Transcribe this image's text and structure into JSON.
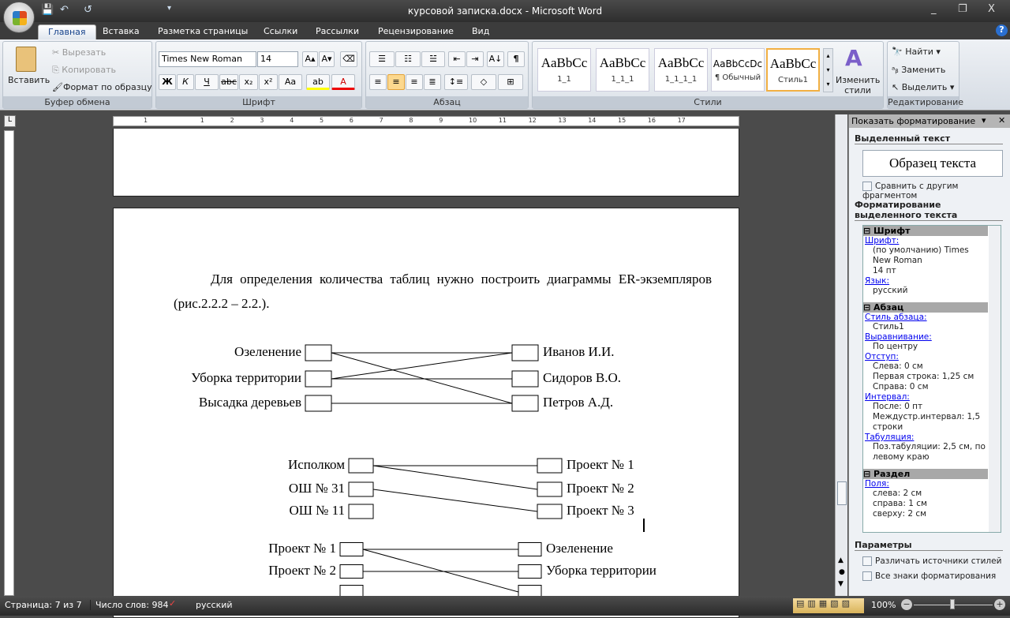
{
  "window": {
    "title": "курсовой записка.docx - Microsoft Word",
    "minimize": "_",
    "restore": "❐",
    "close": "X"
  },
  "quick_access": {
    "save": "💾",
    "undo": "↶",
    "redo": "↺",
    "more": "▾"
  },
  "tabs": [
    "Главная",
    "Вставка",
    "Разметка страницы",
    "Ссылки",
    "Рассылки",
    "Рецензирование",
    "Вид"
  ],
  "help": "?",
  "clipboard": {
    "paste": "Вставить",
    "cut": "Вырезать",
    "copy": "Копировать",
    "format_painter": "Формат по образцу",
    "label": "Буфер обмена"
  },
  "font": {
    "name": "Times New Roman",
    "size": "14",
    "bold": "Ж",
    "italic": "К",
    "underline": "Ч",
    "strike": "abc",
    "sub": "x₂",
    "sup": "x²",
    "case": "Aa",
    "grow": "A▴",
    "shrink": "A▾",
    "label": "Шрифт"
  },
  "paragraph": {
    "label": "Абзац",
    "pilcrow": "¶",
    "sort": "А↓"
  },
  "styles": {
    "items": [
      {
        "preview": "AaBbCc",
        "name": "1_1"
      },
      {
        "preview": "AaBbCc",
        "name": "1_1_1"
      },
      {
        "preview": "AaBbCc",
        "name": "1_1_1_1"
      },
      {
        "preview": "AaBbCcDc",
        "name": "¶ Обычный"
      },
      {
        "preview": "AaBbCc",
        "name": "Стиль1"
      }
    ],
    "change": "Изменить стили",
    "label": "Стили"
  },
  "editing": {
    "find": "Найти",
    "replace": "Заменить",
    "select": "Выделить",
    "label": "Редактирование"
  },
  "ruler": {
    "marks": [
      "1",
      "1",
      "2",
      "3",
      "4",
      "5",
      "6",
      "7",
      "8",
      "9",
      "10",
      "11",
      "12",
      "13",
      "14",
      "15",
      "16",
      "17"
    ]
  },
  "document": {
    "paragraph": "Для определения количества таблиц нужно построить диаграммы ER-экземпляров (рис.2.2.2 – 2.2.).",
    "diagram1": {
      "left": [
        "Озеленение",
        "Уборка территории",
        "Высадка деревьев"
      ],
      "right": [
        "Иванов И.И.",
        "Сидоров В.О.",
        "Петров А.Д."
      ],
      "links": [
        [
          0,
          0
        ],
        [
          0,
          2
        ],
        [
          1,
          0
        ],
        [
          1,
          1
        ],
        [
          2,
          2
        ]
      ]
    },
    "diagram2": {
      "left": [
        "Исполком",
        "ОШ № 31",
        "ОШ № 11"
      ],
      "right": [
        "Проект № 1",
        "Проект № 2",
        "Проект № 3"
      ],
      "links": [
        [
          0,
          0
        ],
        [
          0,
          1
        ],
        [
          1,
          2
        ]
      ]
    },
    "diagram3": {
      "left": [
        "Проект № 1",
        "Проект № 2"
      ],
      "right": [
        "Озеленение",
        "Уборка территории"
      ],
      "links": [
        [
          0,
          0
        ],
        [
          0,
          2
        ],
        [
          1,
          1
        ]
      ]
    }
  },
  "pane": {
    "title": "Показать форматирование",
    "selected_text": "Выделенный текст",
    "sample": "Образец текста",
    "compare": "Сравнить с другим фрагментом",
    "formatting": "Форматирование выделенного текста",
    "sections": [
      {
        "title": "Шрифт",
        "entries": [
          {
            "link": "Шрифт:",
            "values": [
              "(по умолчанию) Times New Roman",
              "14 пт"
            ]
          },
          {
            "link": "Язык:",
            "values": [
              "русский"
            ]
          }
        ]
      },
      {
        "title": "Абзац",
        "entries": [
          {
            "link": "Стиль абзаца:",
            "values": [
              "Стиль1"
            ]
          },
          {
            "link": "Выравнивание:",
            "values": [
              "По центру"
            ]
          },
          {
            "link": "Отступ:",
            "values": [
              "Слева:  0 см",
              "Первая строка:  1,25 см",
              "Справа:  0 см"
            ]
          },
          {
            "link": "Интервал:",
            "values": [
              "После:  0 пт",
              "Междустр.интервал:  1,5 строки"
            ]
          },
          {
            "link": "Табуляция:",
            "values": [
              "Поз.табуляции:  2,5 см, по левому краю"
            ]
          }
        ]
      },
      {
        "title": "Раздел",
        "entries": [
          {
            "link": "Поля:",
            "values": [
              "слева:  2 см",
              "справа:  1 см",
              "сверху:  2 см"
            ]
          }
        ]
      }
    ],
    "params": "Параметры",
    "distinguish": "Различать источники стилей",
    "all_marks": "Все знаки форматирования"
  },
  "status": {
    "page": "Страница: 7 из 7",
    "words": "Число слов: 984",
    "language": "русский",
    "zoom": "100%"
  }
}
